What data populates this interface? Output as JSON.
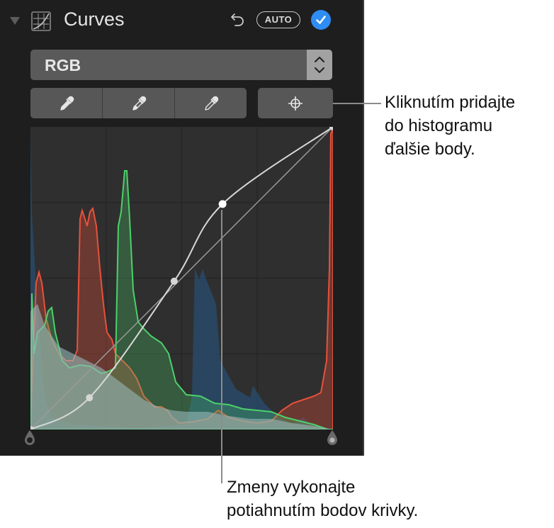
{
  "panel": {
    "title": "Curves",
    "auto_label": "AUTO",
    "icons": {
      "disclosure": "disclosure-triangle-down",
      "section": "curves-grid-icon",
      "undo": "undo-arrow-icon",
      "enabled": "checkmark-circle-icon"
    },
    "channel_select": {
      "selected": "RGB"
    },
    "eyedroppers": [
      {
        "name": "black-point-eyedropper",
        "icon": "eyedropper-filled"
      },
      {
        "name": "gray-point-eyedropper",
        "icon": "eyedropper-half"
      },
      {
        "name": "white-point-eyedropper",
        "icon": "eyedropper-outline"
      }
    ],
    "add_point_icon": "crosshair-icon",
    "colors": {
      "accent": "#2f8cf2",
      "red": "#e8513b",
      "green": "#4cd16a",
      "blue": "#2c4d6b",
      "curve": "#d8d8d8"
    },
    "curve_points": [
      {
        "in": 0.0,
        "out": 0.0
      },
      {
        "in": 0.195,
        "out": 0.105
      },
      {
        "in": 0.475,
        "out": 0.49
      },
      {
        "in": 0.635,
        "out": 0.745
      },
      {
        "in": 1.0,
        "out": 1.0
      }
    ]
  },
  "callouts": {
    "add_points": "Kliknutím pridajte\ndo histogramu\nďalšie body.",
    "drag_points": "Zmeny vykonajte\npotiahnutím bodov krivky."
  }
}
